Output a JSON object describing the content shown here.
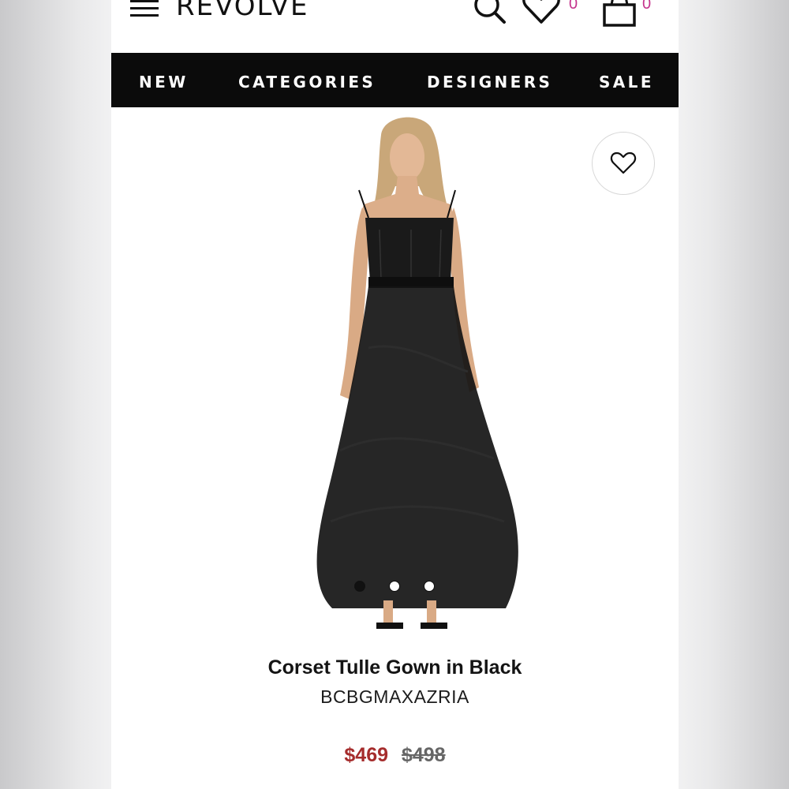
{
  "header": {
    "logo": "REVOLVE",
    "wishlist_count": "0",
    "bag_count": "0"
  },
  "nav": {
    "items": [
      "NEW",
      "CATEGORIES",
      "DESIGNERS",
      "SALE"
    ]
  },
  "gallery": {
    "image_count": 3,
    "active_index": 0
  },
  "product": {
    "title": "Corset Tulle Gown in Black",
    "brand": "BCBGMAXAZRIA",
    "sale_price": "$469",
    "original_price": "$498"
  },
  "colors": {
    "nav_bg": "#0b0b0b",
    "accent_count": "#c4348d",
    "sale_price": "#a52c2c"
  }
}
